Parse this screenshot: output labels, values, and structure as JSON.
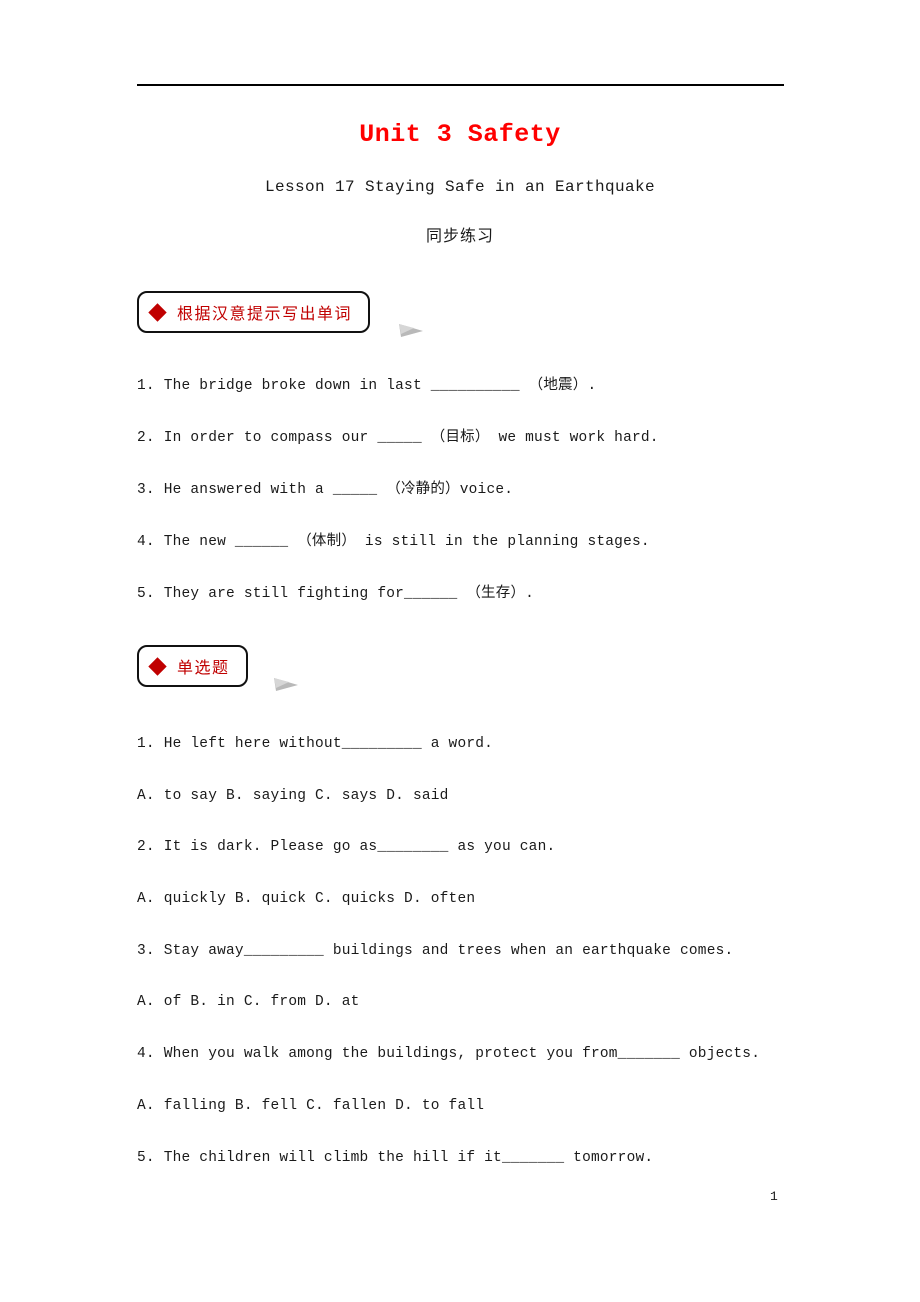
{
  "document": {
    "title": "Unit 3 Safety",
    "subtitle": "Lesson 17 Staying Safe in an Earthquake",
    "subtitle2": "同步练习",
    "page_number": "1",
    "title_color": "#ff0000",
    "accent_color": "#c00000"
  },
  "sections": [
    {
      "badge_label": "根据汉意提示写出单词",
      "items": [
        {
          "text": "1. The  bridge  broke down  in  last  __________ （地震）."
        },
        {
          "text": "2. In order to  compass  our  _____ （目标） we  must  work hard."
        },
        {
          "text": "3. He  answered  with a  _____ （冷静的）voice."
        },
        {
          "text": "4. The new  ______ （体制） is still in the planning stages."
        },
        {
          "text": "5. They  are still  fighting  for______ （生存）."
        }
      ]
    },
    {
      "badge_label": "单选题",
      "items": [
        {
          "text": "1. He left here without_________ a word."
        },
        {
          "text": "A. to say   B. saying   C. says   D. said"
        },
        {
          "text": "2. It is dark. Please go as________ as you can."
        },
        {
          "text": "A. quickly    B. quick    C. quicks   D. often"
        },
        {
          "text": "3. Stay away_________ buildings and trees when an earthquake comes."
        },
        {
          "text": "A. of     B. in    C. from     D. at"
        },
        {
          "text": "4. When you walk among the buildings, protect you from_______ objects."
        },
        {
          "text": "A. falling       B. fell  C. fallen  D. to fall"
        },
        {
          "text": "5. The children will climb the hill if it_______ tomorrow."
        }
      ]
    }
  ]
}
